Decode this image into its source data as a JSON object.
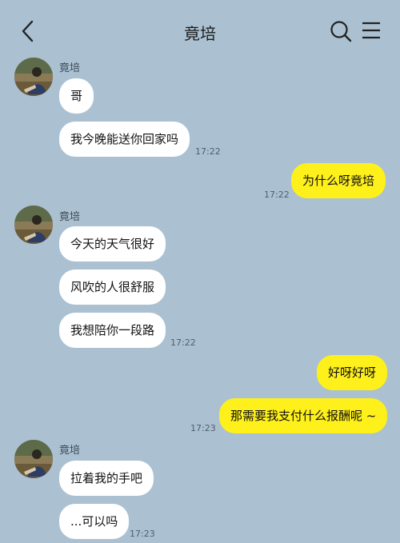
{
  "header": {
    "title": "竟培",
    "back_icon": "chevron-left-icon",
    "search_icon": "search-icon",
    "menu_icon": "menu-icon"
  },
  "colors": {
    "background": "#abc1d1",
    "incoming_bubble": "#ffffff",
    "outgoing_bubble": "#fef01b"
  },
  "messages": {
    "g1": {
      "sender": "竟培",
      "m1": "哥",
      "m2": "我今晚能送你回家吗",
      "time": "17:22"
    },
    "o1": {
      "m1": "为什么呀竟培",
      "time": "17:22"
    },
    "g2": {
      "sender": "竟培",
      "m1": "今天的天气很好",
      "m2": "风吹的人很舒服",
      "m3": "我想陪你一段路",
      "time": "17:22"
    },
    "o2": {
      "m1": "好呀好呀",
      "m2": "那需要我支付什么报酬呢 ~",
      "time": "17:23"
    },
    "g3": {
      "sender": "竟培",
      "m1": "拉着我的手吧",
      "m2": "...可以吗",
      "time": "17:23"
    }
  }
}
